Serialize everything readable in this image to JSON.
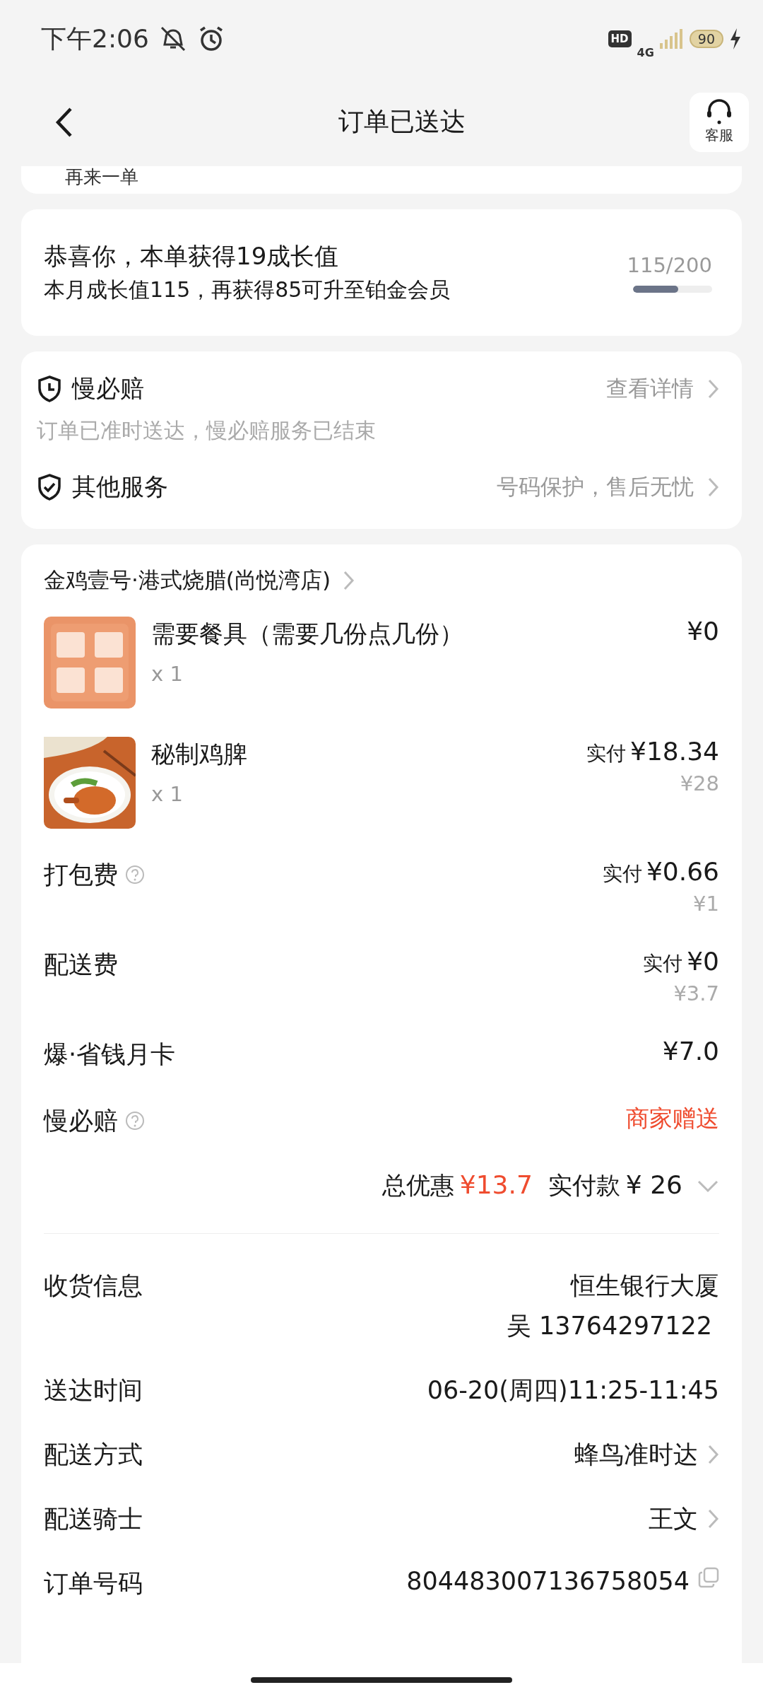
{
  "status_bar": {
    "time": "下午2:06",
    "hd_label": "HD",
    "network": "4G",
    "battery": "90"
  },
  "header": {
    "title": "订单已送达",
    "service_label": "客服"
  },
  "reorder": {
    "label": "再来一单"
  },
  "growth": {
    "title": "恭喜你，本单获得19成长值",
    "subtitle": "本月成长值115，再获得85可升至铂金会员",
    "progress_text": "115/200",
    "level": 0.575
  },
  "services": [
    {
      "kind": "clock",
      "title": "慢必赔",
      "link": "查看详情",
      "note": "订单已准时送达，慢必赔服务已结束"
    },
    {
      "kind": "check",
      "title": "其他服务",
      "link": "号码保护，售后无忧"
    }
  ],
  "shop": {
    "name": "金鸡壹号·港式烧腊(尚悦湾店)"
  },
  "items": [
    {
      "kind": "tableware",
      "name": "需要餐具（需要几份点几份）",
      "qty": "x 1",
      "price": "¥0"
    },
    {
      "kind": "chicken",
      "name": "秘制鸡脾",
      "qty": "x 1",
      "paid_label": "实付",
      "price": "¥18.34",
      "original_price": "¥28"
    }
  ],
  "fees": [
    {
      "label": "打包费",
      "help": true,
      "paid_label": "实付",
      "price": "¥0.66",
      "original_price": "¥1",
      "highlight": false
    },
    {
      "label": "配送费",
      "help": false,
      "paid_label": "实付",
      "price": "¥0",
      "original_price": "¥3.7",
      "highlight": false
    },
    {
      "label": "爆·省钱月卡",
      "help": false,
      "price": "¥7.0",
      "highlight": false
    },
    {
      "label": "慢必赔",
      "help": true,
      "price": "商家赠送",
      "highlight": true
    }
  ],
  "summary": {
    "discount_label": "总优惠",
    "discount": "¥13.7",
    "paid_label": "实付款",
    "paid": "¥ 26",
    "expanded": false
  },
  "details": [
    {
      "label": "收货信息",
      "lines": [
        "恒生银行大厦",
        "吴 13764297122"
      ]
    },
    {
      "label": "送达时间",
      "lines": [
        "06-20(周四)11:25-11:45"
      ]
    },
    {
      "label": "配送方式",
      "lines": [
        "蜂鸟准时达"
      ],
      "kind": "link"
    },
    {
      "label": "配送骑士",
      "lines": [
        "王文"
      ],
      "kind": "link"
    },
    {
      "label": "订单号码",
      "lines": [
        "804483007136758054"
      ],
      "kind": "copyable"
    }
  ]
}
